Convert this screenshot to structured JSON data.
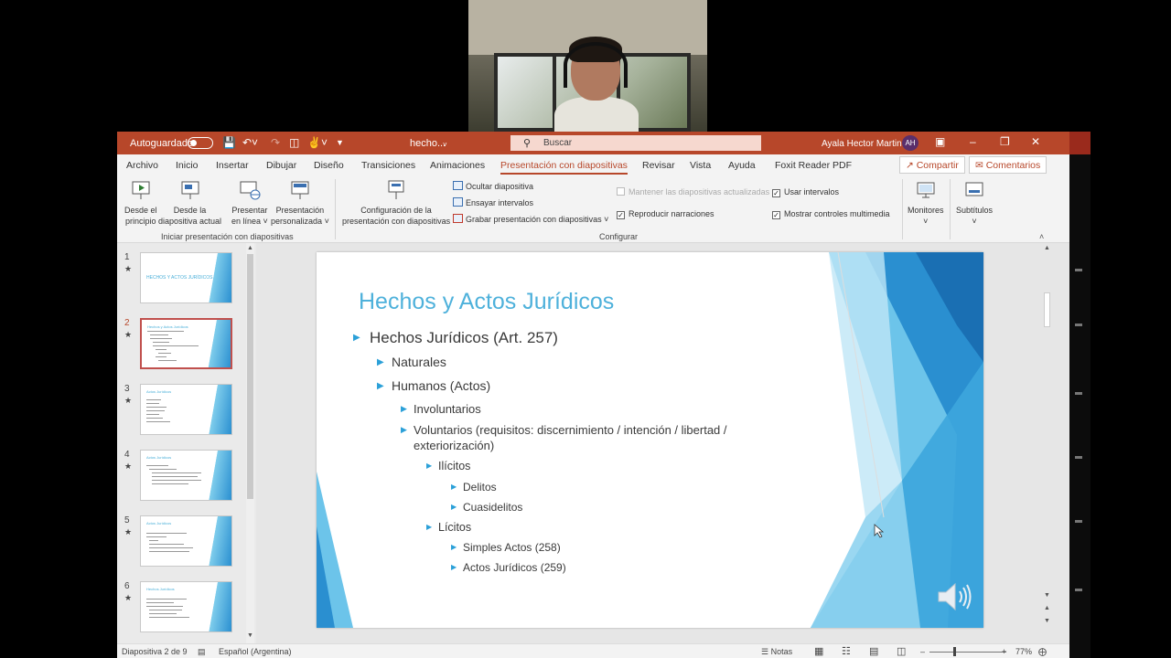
{
  "titlebar": {
    "autosave": "Autoguardado",
    "doc_name": "hecho...",
    "search_placeholder": "Buscar",
    "user_name": "Ayala Hector Martin",
    "user_initials": "AH"
  },
  "tabs": [
    "Archivo",
    "Inicio",
    "Insertar",
    "Dibujar",
    "Diseño",
    "Transiciones",
    "Animaciones",
    "Presentación con diapositivas",
    "Revisar",
    "Vista",
    "Ayuda",
    "Foxit Reader PDF"
  ],
  "active_tab": "Presentación con diapositivas",
  "share_label": "Compartir",
  "comments_label": "Comentarios",
  "ribbon": {
    "desde_principio": [
      "Desde el",
      "principio"
    ],
    "desde_actual": [
      "Desde la",
      "diapositiva actual"
    ],
    "presentar_linea": [
      "Presentar",
      "en línea"
    ],
    "presentacion_personalizada": [
      "Presentación",
      "personalizada"
    ],
    "group_iniciar": "Iniciar presentación con diapositivas",
    "configuracion": [
      "Configuración de la",
      "presentación con diapositivas"
    ],
    "ocultar": "Ocultar diapositiva",
    "ensayar": "Ensayar intervalos",
    "grabar": "Grabar presentación con diapositivas",
    "mantener": "Mantener las diapositivas actualizadas",
    "reproducir": "Reproducir narraciones",
    "usar_intervalos": "Usar intervalos",
    "mostrar_controles": "Mostrar controles multimedia",
    "group_configurar": "Configurar",
    "monitores": "Monitores",
    "subtitulos": "Subtítulos"
  },
  "thumbnails": [
    {
      "num": "1",
      "title": "HECHOS Y ACTOS JURÍDICOS"
    },
    {
      "num": "2",
      "title": "Hechos y Actos Jurídicos"
    },
    {
      "num": "3",
      "title": "Actos Jurídicos"
    },
    {
      "num": "4",
      "title": "Actos Jurídicos"
    },
    {
      "num": "5",
      "title": "Actos Jurídicos"
    },
    {
      "num": "6",
      "title": "Hechos Jurídicos"
    }
  ],
  "slide": {
    "title": "Hechos y Actos Jurídicos",
    "bullets": [
      "Hechos Jurídicos (Art. 257)",
      "Naturales",
      "Humanos (Actos)",
      "Involuntarios",
      "Voluntarios (requisitos: discernimiento / intención / libertad /",
      "exteriorización)",
      "Ilícitos",
      "Delitos",
      "Cuasidelitos",
      "Lícitos",
      "Simples Actos (258)",
      "Actos Jurídicos (259)"
    ]
  },
  "status": {
    "slide_info": "Diapositiva 2 de 9",
    "language": "Español (Argentina)",
    "notes": "Notas",
    "zoom": "77%"
  },
  "colors": {
    "accent": "#b7472a",
    "slide_title": "#4eb1db",
    "bullet": "#2ba0d8"
  }
}
